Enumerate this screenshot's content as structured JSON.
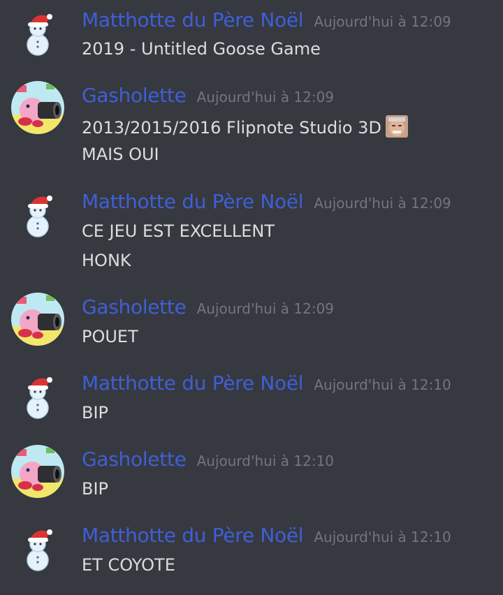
{
  "messages": [
    {
      "author": "Matthotte du Père Noël",
      "timestamp": "Aujourd'hui à 12:09",
      "avatar_icon": "snowman-santa-hat-icon",
      "lines": [
        "2019 - Untitled Goose Game"
      ]
    },
    {
      "author": "Gasholette",
      "timestamp": "Aujourd'hui à 12:09",
      "avatar_icon": "kirby-cannon-icon",
      "lines": [
        "2013/2015/2016 Flipnote Studio 3D",
        "MAIS OUI"
      ],
      "emoji_icon": "old-man-face-emoji-icon"
    },
    {
      "author": "Matthotte du Père Noël",
      "timestamp": "Aujourd'hui à 12:09",
      "avatar_icon": "snowman-santa-hat-icon",
      "lines": [
        "CE JEU EST EXCELLENT",
        "HONK"
      ]
    },
    {
      "author": "Gasholette",
      "timestamp": "Aujourd'hui à 12:09",
      "avatar_icon": "kirby-cannon-icon",
      "lines": [
        "POUET"
      ]
    },
    {
      "author": "Matthotte du Père Noël",
      "timestamp": "Aujourd'hui à 12:10",
      "avatar_icon": "snowman-santa-hat-icon",
      "lines": [
        "BIP"
      ]
    },
    {
      "author": "Gasholette",
      "timestamp": "Aujourd'hui à 12:10",
      "avatar_icon": "kirby-cannon-icon",
      "lines": [
        "BIP"
      ]
    },
    {
      "author": "Matthotte du Père Noël",
      "timestamp": "Aujourd'hui à 12:10",
      "avatar_icon": "snowman-santa-hat-icon",
      "lines": [
        "ET COYOTE"
      ]
    }
  ],
  "colors": {
    "background": "#36393f",
    "author": "#3f5fd8",
    "timestamp": "#72767d",
    "text": "#dcddde"
  }
}
